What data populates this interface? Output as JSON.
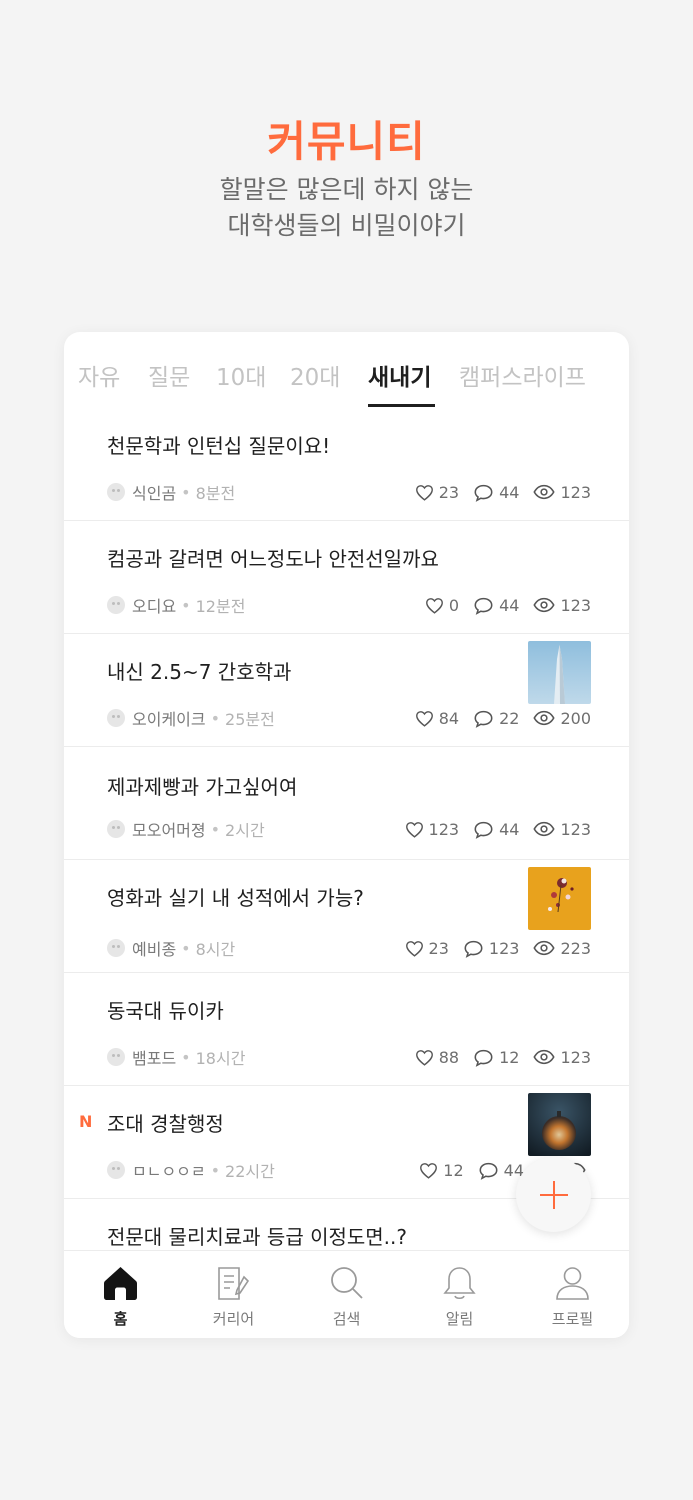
{
  "hero": {
    "title": "커뮤니티",
    "subtitle_line1": "할말은 많은데 하지 않는",
    "subtitle_line2": "대학생들의 비밀이야기"
  },
  "tabs": [
    {
      "label": "자유",
      "active": false
    },
    {
      "label": "질문",
      "active": false
    },
    {
      "label": "10대",
      "active": false
    },
    {
      "label": "20대",
      "active": false
    },
    {
      "label": "새내기",
      "active": true
    },
    {
      "label": "캠퍼스라이프",
      "active": false
    }
  ],
  "posts": [
    {
      "title": "천문학과 인턴십 질문이요!",
      "author": "식인곰",
      "time": "8분전",
      "likes": "23",
      "comments": "44",
      "views": "123",
      "thumbnail": null,
      "new": false
    },
    {
      "title": "컴공과 갈려면 어느정도나 안전선일까요",
      "author": "오디요",
      "time": "12분전",
      "likes": "0",
      "comments": "44",
      "views": "123",
      "thumbnail": null,
      "new": false
    },
    {
      "title": "내신 2.5~7 간호학과",
      "author": "오이케이크",
      "time": "25분전",
      "likes": "84",
      "comments": "22",
      "views": "200",
      "thumbnail": "tower-photo",
      "new": false
    },
    {
      "title": "제과제빵과 가고싶어여",
      "author": "모오어머졍",
      "time": "2시간",
      "likes": "123",
      "comments": "44",
      "views": "123",
      "thumbnail": null,
      "new": false
    },
    {
      "title": "영화과 실기 내 성적에서 가능?",
      "author": "예비종",
      "time": "8시간",
      "likes": "23",
      "comments": "123",
      "views": "223",
      "thumbnail": "flowers-photo",
      "new": false
    },
    {
      "title": "동국대 듀이카",
      "author": "뱀포드",
      "time": "18시간",
      "likes": "88",
      "comments": "12",
      "views": "123",
      "thumbnail": null,
      "new": false
    },
    {
      "title": "조대 경찰행정",
      "author": "ㅁㄴㅇㅇㄹ",
      "time": "22시간",
      "likes": "12",
      "comments": "44",
      "views": "",
      "thumbnail": "glass-sphere-photo",
      "new": true,
      "new_label": "N"
    },
    {
      "title": "전문대 물리치료과 등급 이정도면..?",
      "author": "",
      "time": "",
      "likes": "",
      "comments": "",
      "views": "",
      "thumbnail": null,
      "new": false
    }
  ],
  "meta": {
    "separator": "•"
  },
  "fab": {
    "icon": "plus-icon"
  },
  "bottom_nav": [
    {
      "label": "홈",
      "icon": "home-icon",
      "active": true
    },
    {
      "label": "커리어",
      "icon": "document-icon",
      "active": false
    },
    {
      "label": "검색",
      "icon": "search-icon",
      "active": false
    },
    {
      "label": "알림",
      "icon": "bell-icon",
      "active": false
    },
    {
      "label": "프로필",
      "icon": "profile-icon",
      "active": false
    }
  ],
  "colors": {
    "accent": "#ff6b3d",
    "text": "#1f1f1f",
    "muted": "#7a7a7a",
    "background": "#f4f4f4"
  }
}
